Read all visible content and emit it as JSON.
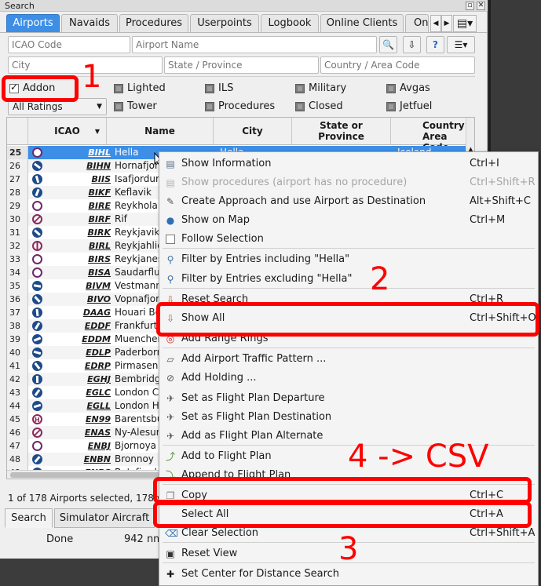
{
  "window": {
    "title": "Search"
  },
  "tabs": [
    {
      "label": "Airports",
      "active": true
    },
    {
      "label": "Navaids"
    },
    {
      "label": "Procedures"
    },
    {
      "label": "Userpoints"
    },
    {
      "label": "Logbook"
    },
    {
      "label": "Online Clients"
    },
    {
      "label": "On"
    }
  ],
  "search": {
    "icao_placeholder": "ICAO Code",
    "name_placeholder": "Airport Name",
    "city_placeholder": "City",
    "state_placeholder": "State / Province",
    "country_placeholder": "Country / Area Code"
  },
  "filters": {
    "addon": "Addon",
    "lighted": "Lighted",
    "ils": "ILS",
    "military": "Military",
    "avgas": "Avgas",
    "ratings": "All Ratings",
    "tower": "Tower",
    "procedures": "Procedures",
    "closed": "Closed",
    "jetfuel": "Jetfuel"
  },
  "table": {
    "headers": {
      "icao": "ICAO",
      "name": "Name",
      "city": "City",
      "state": "State or Province",
      "country": "Country Area Code"
    },
    "selected_row": {
      "num": "25",
      "icao": "BIHL",
      "name": "Hella",
      "city": "Hella",
      "country": "Iceland"
    },
    "rows": [
      {
        "num": "25",
        "icao": "BIHL",
        "name": "Hella",
        "icon": "ring"
      },
      {
        "num": "26",
        "icao": "BIHN",
        "name": "Hornafjordur",
        "icon": "rwy"
      },
      {
        "num": "27",
        "icao": "BIIS",
        "name": "Isafjordur",
        "icon": "rwy"
      },
      {
        "num": "28",
        "icao": "BIKF",
        "name": "Keflavik",
        "icon": "rwy"
      },
      {
        "num": "29",
        "icao": "BIRE",
        "name": "Reykholar",
        "icon": "ring"
      },
      {
        "num": "30",
        "icao": "BIRF",
        "name": "Rif",
        "icon": "ringslash"
      },
      {
        "num": "31",
        "icao": "BIRK",
        "name": "Reykjavik",
        "icon": "rwy"
      },
      {
        "num": "32",
        "icao": "BIRL",
        "name": "Reykjahlid",
        "icon": "ringbar"
      },
      {
        "num": "33",
        "icao": "BIRS",
        "name": "Reykjanes",
        "icon": "ring"
      },
      {
        "num": "34",
        "icao": "BISA",
        "name": "Saudarflugvollur",
        "icon": "ring"
      },
      {
        "num": "35",
        "icao": "BIVM",
        "name": "Vestmannaeyjar",
        "icon": "rwy"
      },
      {
        "num": "36",
        "icao": "BIVO",
        "name": "Vopnafjordur",
        "icon": "rwy"
      },
      {
        "num": "37",
        "icao": "DAAG",
        "name": "Houari Boumediene",
        "icon": "rwy"
      },
      {
        "num": "38",
        "icao": "EDDF",
        "name": "Frankfurt Am Main",
        "icon": "rwy"
      },
      {
        "num": "39",
        "icao": "EDDM",
        "name": "Muenchen Franz Josef",
        "icon": "rwy"
      },
      {
        "num": "40",
        "icao": "EDLP",
        "name": "Paderborn Lippstadt",
        "icon": "rwy"
      },
      {
        "num": "41",
        "icao": "EDRP",
        "name": "Pirmasens",
        "icon": "rwy"
      },
      {
        "num": "42",
        "icao": "EGHJ",
        "name": "Bembridge",
        "icon": "rwy"
      },
      {
        "num": "43",
        "icao": "EGLC",
        "name": "London City",
        "icon": "rwy"
      },
      {
        "num": "44",
        "icao": "EGLL",
        "name": "London Heathrow",
        "icon": "rwy"
      },
      {
        "num": "45",
        "icao": "EN99",
        "name": "Barentsburg",
        "icon": "heli"
      },
      {
        "num": "46",
        "icao": "ENAS",
        "name": "Ny-Alesund",
        "icon": "ringslash"
      },
      {
        "num": "47",
        "icao": "ENBJ",
        "name": "Bjornoya",
        "icon": "ring"
      },
      {
        "num": "48",
        "icao": "ENBN",
        "name": "Bronnoy",
        "icon": "rwy"
      },
      {
        "num": "49",
        "icao": "ENBS",
        "name": "Batsfjord",
        "icon": "rwy"
      }
    ]
  },
  "status": {
    "selection": "1 of 178 Airports selected, 178 v",
    "done": "Done",
    "distance": "942 nm"
  },
  "bottom_tabs": [
    "Search",
    "Simulator Aircraft"
  ],
  "menu": [
    {
      "label": "Show Information",
      "shortcut": "Ctrl+I",
      "icon": "info"
    },
    {
      "label": "Show procedures (airport has no procedure)",
      "shortcut": "Ctrl+Shift+R",
      "disabled": true,
      "icon": "proc"
    },
    {
      "label": "Create Approach and use Airport as Destination",
      "shortcut": "Alt+Shift+C",
      "icon": "approach"
    },
    {
      "label": "Show on Map",
      "shortcut": "Ctrl+M",
      "icon": "globe"
    },
    {
      "label": "Follow Selection",
      "shortcut": "",
      "icon": "checkbox"
    },
    {
      "label": "Filter by Entries including \"Hella\"",
      "shortcut": "",
      "icon": "filter"
    },
    {
      "label": "Filter by Entries excluding \"Hella\"",
      "shortcut": "",
      "icon": "filter"
    },
    {
      "label": "Reset Search",
      "shortcut": "Ctrl+R",
      "icon": "reset"
    },
    {
      "label": "Show All",
      "shortcut": "Ctrl+Shift+O",
      "icon": "showall"
    },
    {
      "label": "Add Range Rings",
      "shortcut": "",
      "icon": "rings"
    },
    {
      "label": "Add Airport Traffic Pattern ...",
      "shortcut": "",
      "icon": "pattern"
    },
    {
      "label": "Add Holding ...",
      "shortcut": "",
      "icon": "holding"
    },
    {
      "label": "Set as Flight Plan Departure",
      "shortcut": "",
      "icon": "plane"
    },
    {
      "label": "Set as Flight Plan Destination",
      "shortcut": "",
      "icon": "plane"
    },
    {
      "label": "Add as Flight Plan Alternate",
      "shortcut": "",
      "icon": "plane"
    },
    {
      "label": "Add to Flight Plan",
      "shortcut": "",
      "icon": "addfp"
    },
    {
      "label": "Append to Flight Plan",
      "shortcut": "",
      "icon": "appendfp"
    },
    {
      "label": "Copy",
      "shortcut": "Ctrl+C",
      "icon": "copy"
    },
    {
      "label": "Select All",
      "shortcut": "Ctrl+A",
      "icon": ""
    },
    {
      "label": "Clear Selection",
      "shortcut": "Ctrl+Shift+A",
      "icon": "clear"
    },
    {
      "label": "Reset View",
      "shortcut": "",
      "icon": "resetview"
    },
    {
      "label": "Set Center for Distance Search",
      "shortcut": "",
      "icon": "center"
    }
  ],
  "annotations": {
    "n1": "1",
    "n2": "2",
    "n3": "3",
    "n4": "4 -> CSV"
  },
  "colors": {
    "accent": "#3d8ee6",
    "annotation": "#ff0000"
  }
}
